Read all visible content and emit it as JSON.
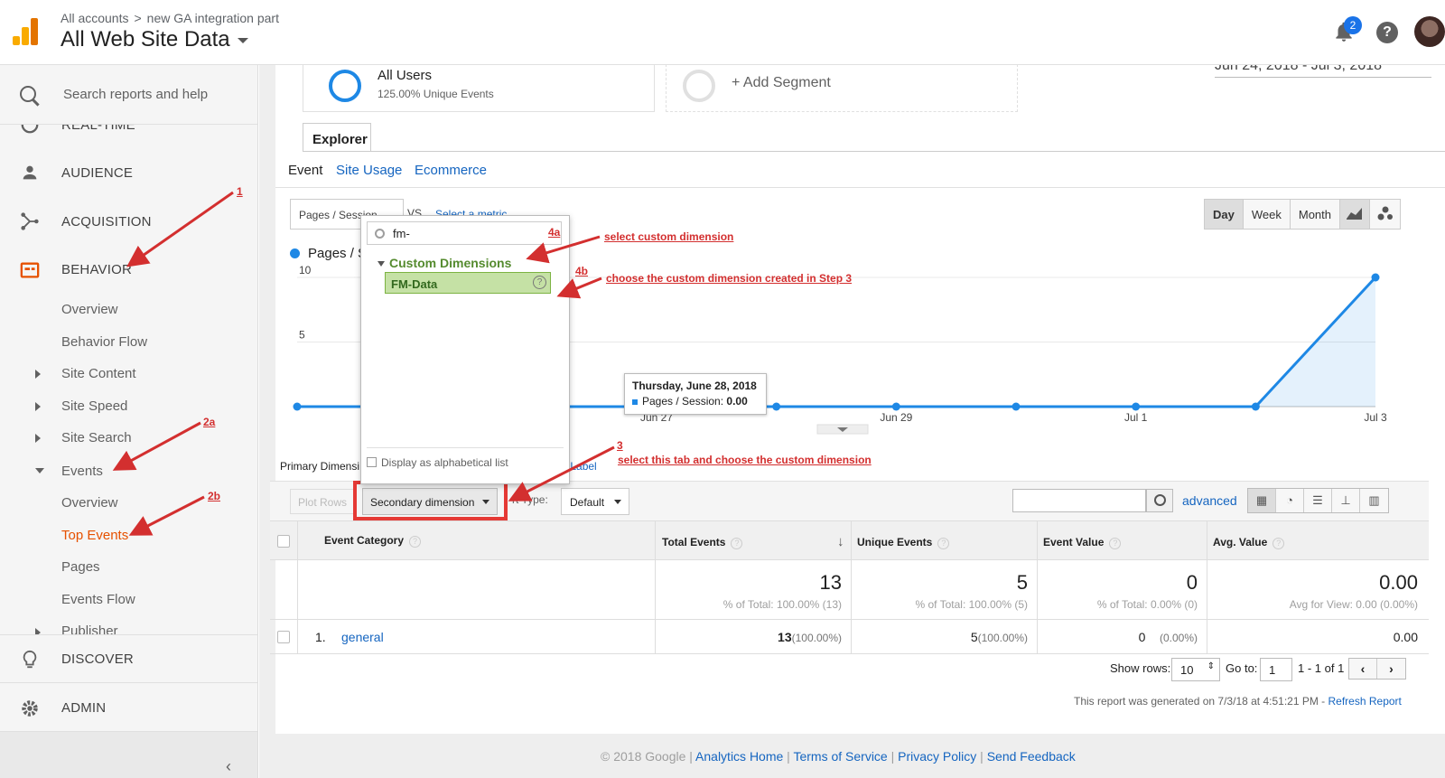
{
  "header": {
    "breadcrumb_root": "All accounts",
    "breadcrumb_sep": ">",
    "breadcrumb_property": "new GA integration part",
    "view_name": "All Web Site Data",
    "notification_count": "2",
    "help_symbol": "?"
  },
  "sidebar": {
    "search_label": "Search reports and help",
    "items": {
      "realtime": "REAL-TIME",
      "audience": "AUDIENCE",
      "acquisition": "ACQUISITION",
      "behavior": "BEHAVIOR",
      "overview": "Overview",
      "behavior_flow": "Behavior Flow",
      "site_content": "Site Content",
      "site_speed": "Site Speed",
      "site_search": "Site Search",
      "events": "Events",
      "events_overview": "Overview",
      "top_events": "Top Events",
      "pages": "Pages",
      "events_flow": "Events Flow",
      "publisher": "Publisher",
      "discover": "DISCOVER",
      "admin": "ADMIN"
    },
    "collapse_symbol": "‹"
  },
  "segments": {
    "all_users_title": "All Users",
    "all_users_sub": "125.00% Unique Events",
    "add_segment": "+ Add Segment",
    "date_range": "Jun 24, 2018 - Jul 3, 2018"
  },
  "explorer": {
    "tab": "Explorer",
    "subtabs": [
      "Event",
      "Site Usage",
      "Ecommerce"
    ],
    "metric_select": "Pages / Session",
    "vs": "VS.",
    "select_metric": "Select a metric",
    "time_buttons": [
      "Day",
      "Week",
      "Month"
    ],
    "legend": "Pages / Session"
  },
  "dropdown": {
    "search_value": "fm-",
    "group": "Custom Dimensions",
    "item": "FM-Data",
    "alpha_label": "Display as alphabetical list"
  },
  "chart_data": {
    "type": "area",
    "series": [
      {
        "name": "Pages / Session",
        "values": [
          0,
          0,
          0,
          0,
          0,
          0,
          0,
          0,
          0,
          10
        ]
      }
    ],
    "x": [
      "Jun 24",
      "Jun 25",
      "Jun 26",
      "Jun 27",
      "Jun 28",
      "Jun 29",
      "Jun 30",
      "Jul 1",
      "Jul 2",
      "Jul 3"
    ],
    "x_tick_labels": [
      "Jun 27",
      "Jun 29",
      "Jul 1",
      "Jul 3"
    ],
    "y_tick_labels": [
      "10",
      "5"
    ],
    "ylim": [
      0,
      10
    ],
    "color": "#1e88e5",
    "tooltip": {
      "title": "Thursday, June 28, 2018",
      "metric": "Pages / Session:",
      "value": "0.00"
    }
  },
  "table_controls": {
    "primary_dimension": "Primary Dimensi",
    "event_label_fragment": "nt Label",
    "plot_rows": "Plot Rows",
    "secondary_dimension": "Secondary dimension",
    "sort_type": "rt Type:",
    "default": "Default",
    "advanced": "advanced"
  },
  "table": {
    "headers": [
      "Event Category",
      "Total Events",
      "Unique Events",
      "Event Value",
      "Avg. Value"
    ],
    "totals": {
      "total_events": "13",
      "total_events_sub": "% of Total: 100.00% (13)",
      "unique_events": "5",
      "unique_events_sub": "% of Total: 100.00% (5)",
      "event_value": "0",
      "event_value_sub": "% of Total: 0.00% (0)",
      "avg_value": "0.00",
      "avg_value_sub": "Avg for View: 0.00 (0.00%)"
    },
    "rows": [
      {
        "index": "1.",
        "category": "general",
        "total": "13",
        "total_pct": "(100.00%)",
        "unique": "5",
        "unique_pct": "(100.00%)",
        "value": "0",
        "value_pct": "(0.00%)",
        "avg": "0.00"
      }
    ]
  },
  "pager": {
    "show_rows_label": "Show rows:",
    "show_rows_value": "10",
    "goto_label": "Go to:",
    "goto_value": "1",
    "range": "1 - 1 of 1",
    "generated": "This report was generated on 7/3/18 at 4:51:21 PM - ",
    "refresh": "Refresh Report"
  },
  "footer": {
    "copyright": "© 2018 Google | ",
    "analytics_home": "Analytics Home",
    "terms": "Terms of Service",
    "privacy": "Privacy Policy",
    "feedback": "Send Feedback",
    "sep": " | "
  },
  "annotations": {
    "n1": "1",
    "n2a": "2a",
    "n2b": "2b",
    "n3": "3",
    "n3_text": "select this tab and choose the custom dimension",
    "n4a": "4a",
    "n4a_text": "select custom dimension",
    "n4b": "4b",
    "n4b_text": "choose the custom dimension created in Step 3",
    "color": "#d32f2f"
  }
}
